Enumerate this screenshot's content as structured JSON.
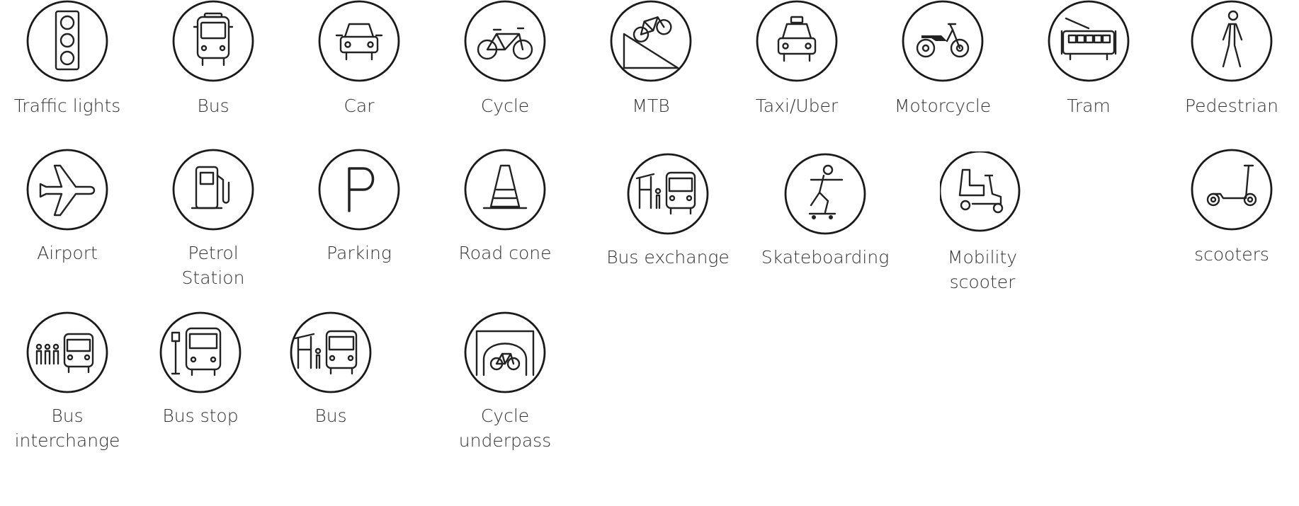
{
  "icons": [
    {
      "name": "traffic-lights-icon",
      "label": "Traffic lights"
    },
    {
      "name": "bus-icon",
      "label": "Bus"
    },
    {
      "name": "car-icon",
      "label": "Car"
    },
    {
      "name": "cycle-icon",
      "label": "Cycle"
    },
    {
      "name": "mtb-icon",
      "label": "MTB"
    },
    {
      "name": "taxi-icon",
      "label": "Taxi/Uber"
    },
    {
      "name": "motorcycle-icon",
      "label": "Motorcycle"
    },
    {
      "name": "tram-icon",
      "label": "Tram"
    },
    {
      "name": "pedestrian-icon",
      "label": "Pedestrian"
    },
    {
      "name": "airport-icon",
      "label": "Airport"
    },
    {
      "name": "petrol-station-icon",
      "label": "Petrol\nStation"
    },
    {
      "name": "parking-icon",
      "label": "Parking"
    },
    {
      "name": "road-cone-icon",
      "label": "Road cone"
    },
    {
      "name": "bus-exchange-icon",
      "label": "Bus exchange"
    },
    {
      "name": "skateboarding-icon",
      "label": "Skateboarding"
    },
    {
      "name": "mobility-scooter-icon",
      "label": "Mobility scooter"
    },
    {
      "name": "scooters-icon",
      "label": "scooters"
    },
    {
      "name": "bus-interchange-icon",
      "label": "Bus interchange"
    },
    {
      "name": "bus-stop-icon",
      "label": "Bus stop"
    },
    {
      "name": "bus-shelter-icon",
      "label": "Bus"
    },
    {
      "name": "cycle-underpass-icon",
      "label": "Cycle\nunderpass"
    }
  ]
}
